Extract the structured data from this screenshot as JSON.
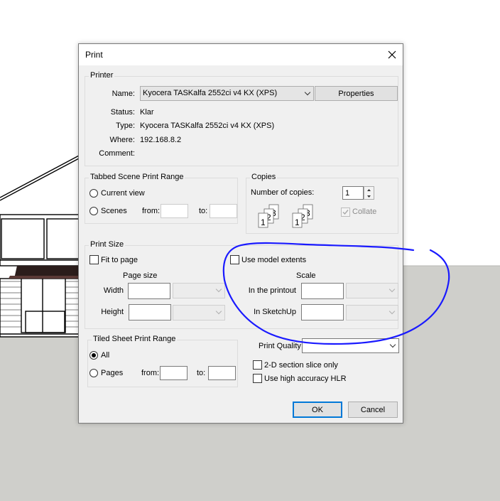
{
  "dialog": {
    "title": "Print"
  },
  "printer": {
    "group_label": "Printer",
    "name_label": "Name:",
    "name_value": "Kyocera TASKalfa 2552ci v4 KX (XPS)",
    "properties_label": "Properties",
    "status_label": "Status:",
    "status_value": "Klar",
    "type_label": "Type:",
    "type_value": "Kyocera TASKalfa 2552ci v4 KX (XPS)",
    "where_label": "Where:",
    "where_value": "192.168.8.2",
    "comment_label": "Comment:",
    "comment_value": ""
  },
  "scene_range": {
    "group_label": "Tabbed Scene Print Range",
    "current_view_label": "Current view",
    "scenes_label": "Scenes",
    "from_label": "from:",
    "to_label": "to:",
    "from_value": "",
    "to_value": ""
  },
  "copies": {
    "group_label": "Copies",
    "number_label": "Number of copies:",
    "number_value": "1",
    "collate_label": "Collate",
    "collate_checked": true,
    "page_digits": [
      "1",
      "2",
      "3"
    ]
  },
  "print_size": {
    "group_label": "Print Size",
    "fit_to_page_label": "Fit to page",
    "page_size_label": "Page size",
    "width_label": "Width",
    "height_label": "Height",
    "use_model_extents_label": "Use model extents",
    "scale_label": "Scale",
    "in_printout_label": "In the printout",
    "in_sketchup_label": "In SketchUp"
  },
  "tiled": {
    "group_label": "Tiled Sheet Print Range",
    "all_label": "All",
    "pages_label": "Pages",
    "from_label": "from:",
    "to_label": "to:"
  },
  "options": {
    "print_quality_label": "Print Quality",
    "print_quality_value": "",
    "section_slice_label": "2-D section slice only",
    "hlr_label": "Use high accuracy HLR"
  },
  "buttons": {
    "ok": "OK",
    "cancel": "Cancel"
  },
  "colors": {
    "accent": "#0078d7",
    "annotation": "#1a1aff",
    "ground": "#cfcfcb",
    "roof": "#2b1d1b"
  }
}
